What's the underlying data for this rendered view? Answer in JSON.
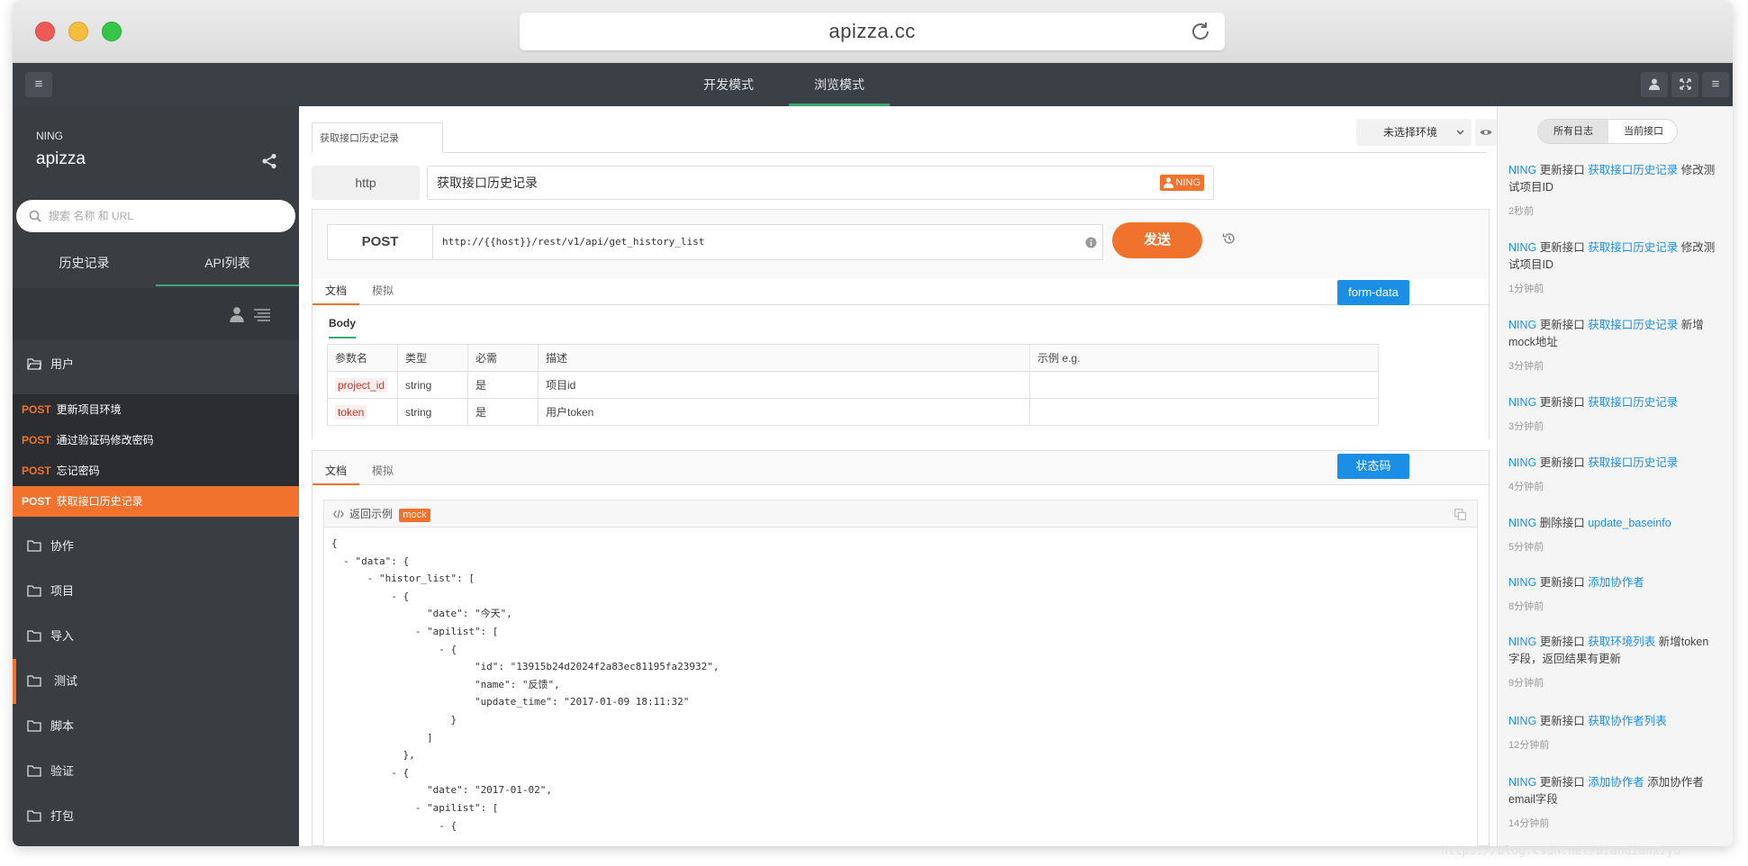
{
  "browser": {
    "url": "apizza.cc"
  },
  "topbar": {
    "tabs": [
      {
        "label": "开发模式"
      },
      {
        "label": "浏览模式"
      }
    ]
  },
  "sidebar": {
    "user": "NING",
    "app_name": "apizza",
    "search_placeholder": "搜索 名称 和 URL",
    "tabs": [
      {
        "label": "历史记录"
      },
      {
        "label": "API列表"
      }
    ],
    "folders_top": [
      {
        "label": "用户"
      }
    ],
    "apis": [
      {
        "method": "POST",
        "name": "更新项目环境"
      },
      {
        "method": "POST",
        "name": "通过验证码修改密码"
      },
      {
        "method": "POST",
        "name": "忘记密码"
      },
      {
        "method": "POST",
        "name": "获取接口历史记录"
      }
    ],
    "folders": [
      {
        "label": "协作"
      },
      {
        "label": "项目"
      },
      {
        "label": "导入"
      },
      {
        "label": "测试"
      },
      {
        "label": "脚本"
      },
      {
        "label": "验证"
      },
      {
        "label": "打包"
      }
    ]
  },
  "main": {
    "doc_tab": "获取接口历史记录",
    "env_select": "未选择环境",
    "protocol": "http",
    "api_name": "获取接口历史记录",
    "owner_badge": "NING",
    "method": "POST",
    "url": "http://{{host}}/rest/v1/api/get_history_list",
    "send_label": "发送",
    "req_tabs": [
      {
        "label": "文档"
      },
      {
        "label": "模拟"
      }
    ],
    "form_data_label": "form-data",
    "body_label": "Body",
    "param_headers": [
      "参数名",
      "类型",
      "必需",
      "描述",
      "示例 e.g."
    ],
    "params": [
      {
        "name": "project_id",
        "type": "string",
        "required": "是",
        "desc": "项目id",
        "example": ""
      },
      {
        "name": "token",
        "type": "string",
        "required": "是",
        "desc": "用户token",
        "example": ""
      }
    ],
    "resp_tabs": [
      {
        "label": "文档"
      },
      {
        "label": "模拟"
      }
    ],
    "status_code_label": "状态码",
    "return_example_label": "返回示例",
    "mock_label": "mock"
  },
  "code": {
    "l1": "{",
    "l2": "  - \"data\": {",
    "l3": "      - \"histor_list\": [",
    "l4": "          - {",
    "l5": "                \"date\": \"今天\",",
    "l6": "              - \"apilist\": [",
    "l7": "                  - {",
    "l8": "                        \"id\": \"13915b24d2024f2a83ec81195fa23932\",",
    "l9": "                        \"name\": \"反馈\",",
    "l10": "                        \"update_time\": \"2017-01-09 18:11:32\"",
    "l11": "                    }",
    "l12": "                ]",
    "l13": "            },",
    "l14": "          - {",
    "l15": "                \"date\": \"2017-01-02\",",
    "l16": "              - \"apilist\": [",
    "l17": "                  - {"
  },
  "log": {
    "toggle": [
      "所有日志",
      "当前接口"
    ],
    "entries": [
      {
        "user": "NING",
        "action": "更新接口",
        "api": "获取接口历史记录",
        "detail": "修改测试项目ID",
        "time": "2秒前"
      },
      {
        "user": "NING",
        "action": "更新接口",
        "api": "获取接口历史记录",
        "detail": "修改测试项目ID",
        "time": "1分钟前"
      },
      {
        "user": "NING",
        "action": "更新接口",
        "api": "获取接口历史记录",
        "detail": "新增mock地址",
        "time": "3分钟前"
      },
      {
        "user": "NING",
        "action": "更新接口",
        "api": "获取接口历史记录",
        "detail": "",
        "time": "3分钟前"
      },
      {
        "user": "NING",
        "action": "更新接口",
        "api": "获取接口历史记录",
        "detail": "",
        "time": "4分钟前"
      },
      {
        "user": "NING",
        "action": "删除接口",
        "api": "update_baseinfo",
        "detail": "",
        "time": "5分钟前"
      },
      {
        "user": "NING",
        "action": "更新接口",
        "api": "添加协作者",
        "detail": "",
        "time": "8分钟前"
      },
      {
        "user": "NING",
        "action": "更新接口",
        "api": "获取环境列表",
        "detail": "新增token字段，返回结果有更新",
        "time": "9分钟前"
      },
      {
        "user": "NING",
        "action": "更新接口",
        "api": "获取协作者列表",
        "detail": "",
        "time": "12分钟前"
      },
      {
        "user": "NING",
        "action": "更新接口",
        "api": "添加协作者",
        "detail": "添加协作者email字段",
        "time": "14分钟前"
      }
    ]
  },
  "watermark": "https://blog.csdn.net/diandianxiyu",
  "colors": {
    "accent_orange": "#f0722d",
    "accent_green": "#3aa873",
    "accent_blue": "#1b8fe6",
    "sidebar_bg": "#3a3d42",
    "topbar_bg": "#3b3f46"
  }
}
